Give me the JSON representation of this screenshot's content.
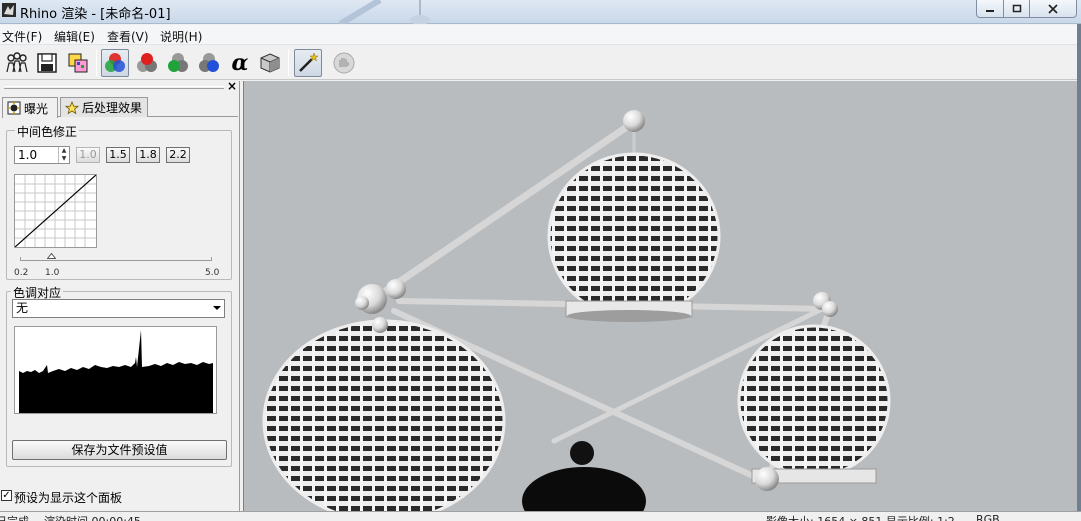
{
  "window": {
    "title": "Rhino 渲染 - [未命名-01]"
  },
  "menu": {
    "items": [
      "文件(F)",
      "编辑(E)",
      "查看(V)",
      "说明(H)"
    ]
  },
  "toolbar": {
    "buttons": [
      {
        "name": "people-icon"
      },
      {
        "name": "save-icon"
      },
      {
        "name": "copy-image-icon"
      },
      {
        "name": "rgb-channels-icon",
        "pressed": true
      },
      {
        "name": "red-channel-icon"
      },
      {
        "name": "green-channel-icon"
      },
      {
        "name": "blue-channel-icon"
      },
      {
        "name": "alpha-icon",
        "glyph": "α"
      },
      {
        "name": "cube-icon"
      },
      {
        "name": "magic-wand-icon",
        "pressed": true
      },
      {
        "name": "stop-icon",
        "disabled": true
      }
    ]
  },
  "panel": {
    "tabs": [
      {
        "label": "曝光",
        "active": true
      },
      {
        "label": "后处理效果",
        "active": false
      }
    ],
    "gamma": {
      "group_label": "中间色修正",
      "value": "1.0",
      "presets": [
        "1.0",
        "1.5",
        "1.8",
        "2.2"
      ],
      "slider_min": "0.2",
      "slider_value": "1.0",
      "slider_max": "5.0"
    },
    "tonemap": {
      "group_label": "色调对应",
      "selected": "无"
    },
    "save_button": "保存为文件预设值",
    "default_checkbox": {
      "label": "预设为显示这个面板",
      "checked": true
    }
  },
  "status": {
    "left": "已完成",
    "render_time": "渲染时间 00:00:45",
    "right": "影像大小: 1654 × 851  显示比例: 1:2",
    "mode": "RGB"
  },
  "colors": {
    "viewport_bg": "#b9bcbf",
    "title_bg": "#dfe8f3",
    "accent_red": "#e0201e",
    "accent_green": "#1fa33a",
    "accent_blue": "#2350d8"
  }
}
